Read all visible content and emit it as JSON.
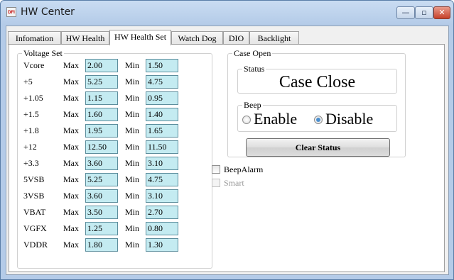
{
  "window": {
    "title": "HW Center",
    "icon_text": "DFI",
    "controls": {
      "minimize": "—",
      "maximize": "▫",
      "close": "✕"
    }
  },
  "tabs": [
    {
      "label": "Infomation"
    },
    {
      "label": "HW Health"
    },
    {
      "label": "HW Health Set",
      "active": true
    },
    {
      "label": "Watch Dog"
    },
    {
      "label": "DIO"
    },
    {
      "label": "Backlight"
    }
  ],
  "voltage_set": {
    "title": "Voltage Set",
    "max_label": "Max",
    "min_label": "Min",
    "rows": [
      {
        "name": "Vcore",
        "max": "2.00",
        "min": "1.50"
      },
      {
        "name": "+5",
        "max": "5.25",
        "min": "4.75"
      },
      {
        "name": "+1.05",
        "max": "1.15",
        "min": "0.95"
      },
      {
        "name": "+1.5",
        "max": "1.60",
        "min": "1.40"
      },
      {
        "name": "+1.8",
        "max": "1.95",
        "min": "1.65"
      },
      {
        "name": "+12",
        "max": "12.50",
        "min": "11.50"
      },
      {
        "name": "+3.3",
        "max": "3.60",
        "min": "3.10"
      },
      {
        "name": "5VSB",
        "max": "5.25",
        "min": "4.75"
      },
      {
        "name": "3VSB",
        "max": "3.60",
        "min": "3.10"
      },
      {
        "name": "VBAT",
        "max": "3.50",
        "min": "2.70"
      },
      {
        "name": "VGFX",
        "max": "1.25",
        "min": "0.80"
      },
      {
        "name": "VDDR",
        "max": "1.80",
        "min": "1.30"
      }
    ]
  },
  "case_open": {
    "title": "Case Open",
    "status_title": "Status",
    "status_value": "Case Close",
    "beep_title": "Beep",
    "enable_label": "Enable",
    "disable_label": "Disable",
    "beep_selected": "Disable",
    "clear_button": "Clear Status"
  },
  "options": {
    "beep_alarm_label": "BeepAlarm",
    "beep_alarm_checked": false,
    "smart_label": "Smart",
    "smart_checked": false,
    "smart_enabled": false
  },
  "colors": {
    "field_bg": "#c4ebf1",
    "field_border": "#5c8d9c",
    "radio_selected": "#4a8fcf"
  }
}
